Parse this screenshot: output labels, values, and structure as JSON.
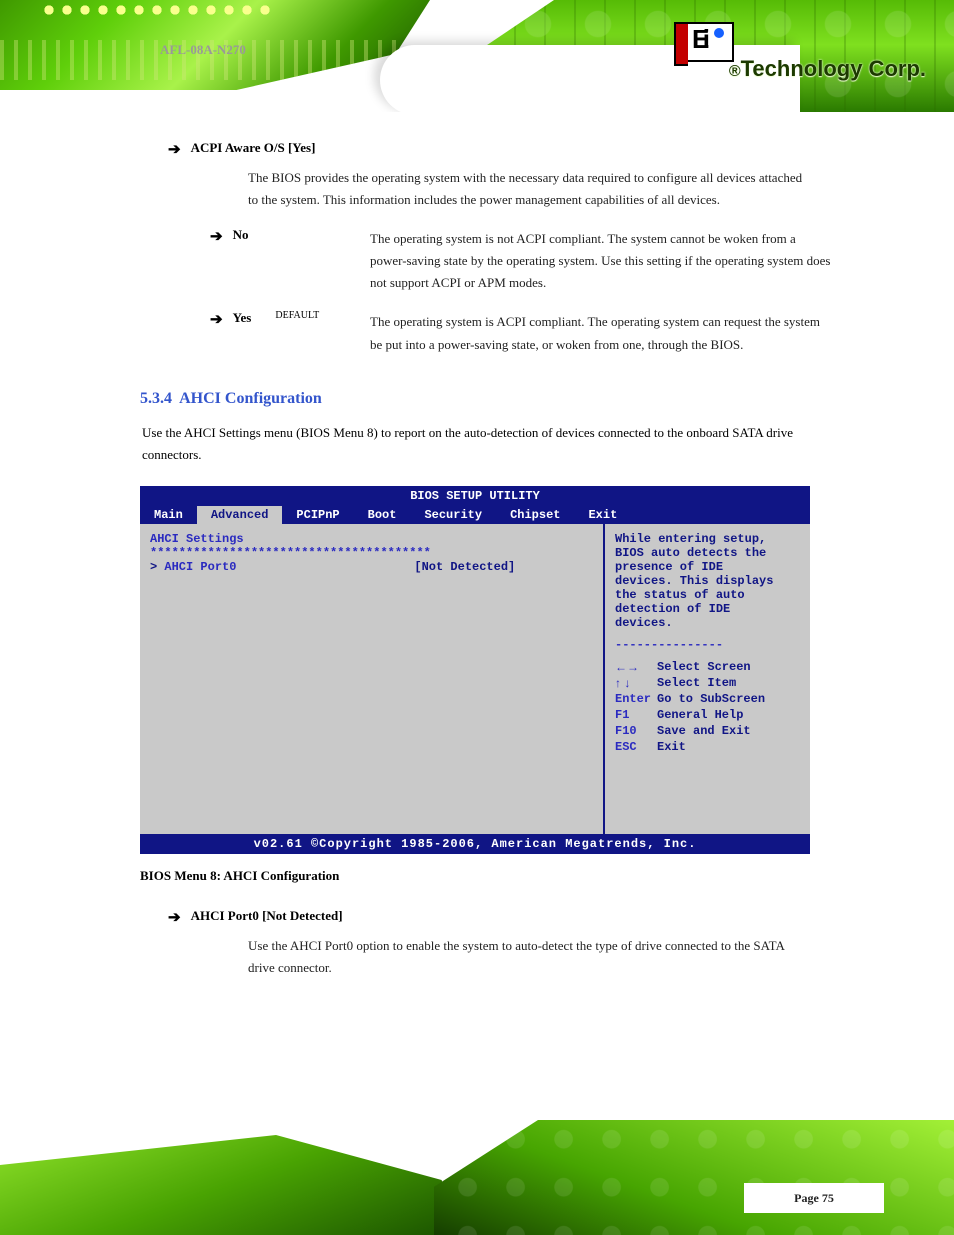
{
  "header": {
    "brand_reg": "®",
    "brand_text": "Technology Corp.",
    "product": "AFL-08A-N270"
  },
  "content": {
    "opt_acpi_name": "ACPI Aware O/S [Yes]",
    "opt_acpi_body": "The BIOS provides the operating system with the necessary data required to configure all devices attached to the system. This information includes the power management capabilities of all devices.",
    "sub_no_name": "No",
    "sub_no_body": "The operating system is not ACPI compliant. The system cannot be woken from a power-saving state by the operating system. Use this setting if the operating system does not support ACPI or APM modes.",
    "sub_yes_name": "Yes",
    "sub_yes_def": "DEFAULT",
    "sub_yes_body": "The operating system is ACPI compliant. The operating system can request the system be put into a power-saving state, or woken from one, through the BIOS.",
    "section_num": "5.3.4",
    "section_title": "AHCI Configuration",
    "section_body": "Use the AHCI Settings menu (BIOS Menu 8) to report on the auto-detection of devices connected to the onboard SATA drive connectors.",
    "fig_caption": "BIOS Menu 8: AHCI Configuration",
    "port0_label": "AHCI Port0 [Not Detected]",
    "port0_body": "Use the AHCI Port0 option to enable the system to auto-detect the type of drive connected to the SATA drive connector.",
    "page_label": "Page 75"
  },
  "bios": {
    "title": "BIOS SETUP UTILITY",
    "tabs": [
      "Main",
      "Advanced",
      "PCIPnP",
      "Boot",
      "Security",
      "Chipset",
      "Exit"
    ],
    "active_tab": 1,
    "left": {
      "heading": "AHCI Settings",
      "row1_label": "AHCI Port0",
      "row1_value": "[Not Detected]"
    },
    "right": {
      "hint1": "While entering setup,",
      "hint2": "BIOS auto detects the",
      "hint3": "presence of IDE",
      "hint4": "devices. This displays",
      "hint5": "the status of auto",
      "hint6": "detection of IDE",
      "hint7": "devices.",
      "k_lr": "Select Screen",
      "k_ud": "Select Item",
      "k_enter_k": "Enter",
      "k_enter_v": "Go to SubScreen",
      "k_f1_k": "F1",
      "k_f1_v": "General Help",
      "k_f10_k": "F10",
      "k_f10_v": "Save and Exit",
      "k_esc_k": "ESC",
      "k_esc_v": "Exit"
    },
    "footer": "v02.61 ©Copyright 1985-2006, American Megatrends, Inc."
  }
}
